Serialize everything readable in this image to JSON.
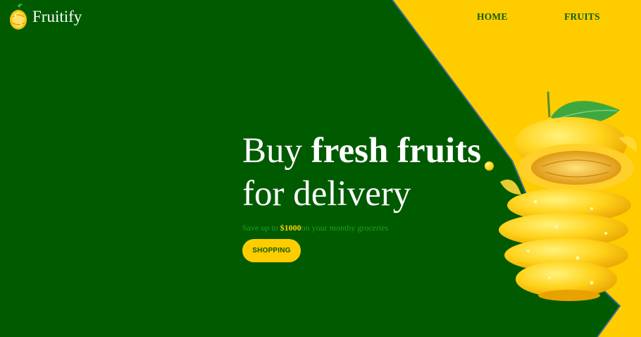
{
  "brand": {
    "name": "Fruitify",
    "logo_icon": "lemon-logo-icon"
  },
  "nav": {
    "items": [
      {
        "label": "HOME"
      },
      {
        "label": "FRUITS"
      }
    ]
  },
  "hero": {
    "headline_prefix": "Buy ",
    "headline_bold": "fresh fruits",
    "headline_line2": "for delivery",
    "subtext_prefix": "Save up to ",
    "subtext_amount": "$1000",
    "subtext_suffix": "on your monthy groceries",
    "button_label": "SHOPPING"
  },
  "colors": {
    "background_green": "#005a00",
    "accent_yellow": "#ffcc00",
    "nav_text": "#0b5e0b"
  }
}
